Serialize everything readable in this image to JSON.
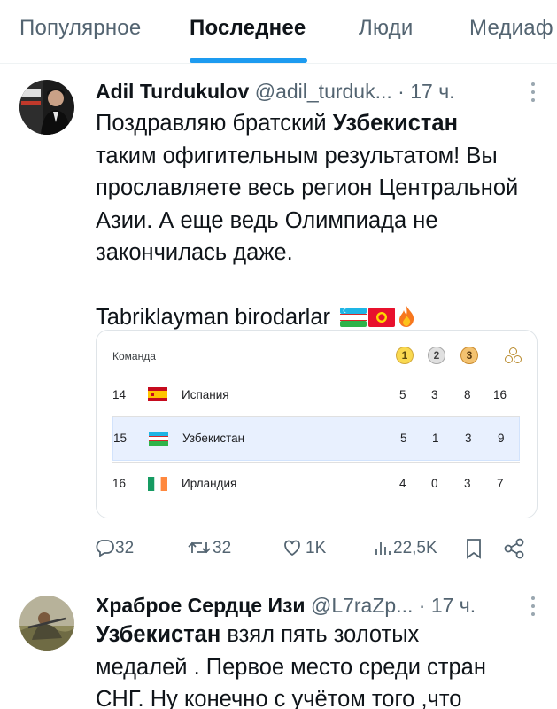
{
  "tabs": [
    "Популярное",
    "Последнее",
    "Люди",
    "Медиаф"
  ],
  "tweets": [
    {
      "name": "Adil Turdukulov",
      "handle": "@adil_turduk...",
      "time": "· 17 ч.",
      "text": {
        "l1_pre": "Поздравляю братский ",
        "l1_bold": "Узбекистан",
        "l2": "таким офигительным результатом! Вы",
        "l3": "прославляете весь регион Центральной",
        "l4": "Азии. А еще ведь Олимпиада не",
        "l5": "закончилась даже.",
        "l6": "Tabriklayman birodarlar"
      },
      "medal_table": {
        "header_team": "Команда",
        "header_icons": [
          "gold-medal-icon",
          "silver-medal-icon",
          "bronze-medal-icon",
          "total-medals-icon"
        ],
        "rows": [
          {
            "rank": "14",
            "country": "Испания",
            "gold": "5",
            "silver": "3",
            "bronze": "8",
            "total": "16"
          },
          {
            "rank": "15",
            "country": "Узбекистан",
            "gold": "5",
            "silver": "1",
            "bronze": "3",
            "total": "9"
          },
          {
            "rank": "16",
            "country": "Ирландия",
            "gold": "4",
            "silver": "0",
            "bronze": "3",
            "total": "7"
          }
        ]
      },
      "stats": {
        "replies": "32",
        "retweets": "32",
        "likes": "1K",
        "views": "22,5K"
      }
    },
    {
      "name": "Храброе Сердце Изи",
      "handle": "@L7raZp...",
      "time": "· 17 ч.",
      "text": {
        "l1_bold": "Узбекистан",
        "l1_post": " взял пять золотых",
        "l2": "медалей . Первое место среди стран",
        "l3": "СНГ.  Ну конечно с учётом того ,что"
      }
    }
  ],
  "colors": {
    "accent": "#1d9bf0",
    "text": "#0f1419",
    "muted": "#536471",
    "highlight": "#e8f0fe"
  }
}
